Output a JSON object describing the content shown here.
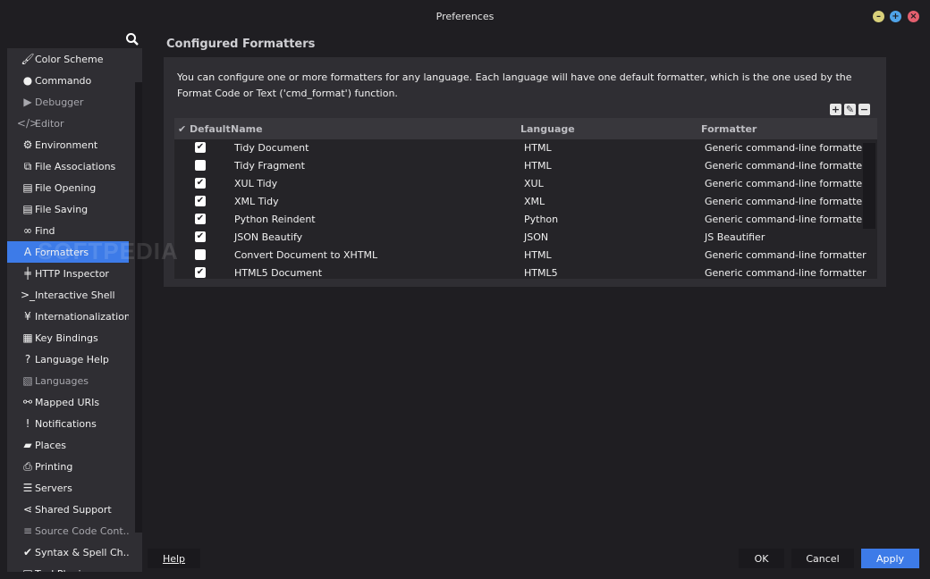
{
  "window": {
    "title": "Preferences"
  },
  "sidebar": {
    "items": [
      {
        "label": "Color Scheme",
        "icon": "brush-icon",
        "glyph": "🖌",
        "dim": false,
        "active": false
      },
      {
        "label": "Commando",
        "icon": "pin-icon",
        "glyph": "●",
        "dim": false,
        "active": false
      },
      {
        "label": "Debugger",
        "icon": "play-icon",
        "glyph": "▶",
        "dim": true,
        "active": false
      },
      {
        "label": "Editor",
        "icon": "code-icon",
        "glyph": "</>",
        "dim": true,
        "active": false
      },
      {
        "label": "Environment",
        "icon": "gear-icon",
        "glyph": "⚙",
        "dim": false,
        "active": false
      },
      {
        "label": "File Associations",
        "icon": "files-icon",
        "glyph": "⧉",
        "dim": false,
        "active": false
      },
      {
        "label": "File Opening",
        "icon": "file-icon",
        "glyph": "▤",
        "dim": false,
        "active": false
      },
      {
        "label": "File Saving",
        "icon": "file-save-icon",
        "glyph": "▤",
        "dim": false,
        "active": false
      },
      {
        "label": "Find",
        "icon": "binoculars-icon",
        "glyph": "∞",
        "dim": false,
        "active": false
      },
      {
        "label": "Formatters",
        "icon": "font-icon",
        "glyph": "A",
        "dim": false,
        "active": true
      },
      {
        "label": "HTTP Inspector",
        "icon": "sliders-icon",
        "glyph": "╪",
        "dim": false,
        "active": false
      },
      {
        "label": "Interactive Shell",
        "icon": "terminal-icon",
        "glyph": ">_",
        "dim": false,
        "active": false
      },
      {
        "label": "Internationalization",
        "icon": "yen-icon",
        "glyph": "¥",
        "dim": false,
        "active": false
      },
      {
        "label": "Key Bindings",
        "icon": "keyboard-icon",
        "glyph": "▦",
        "dim": false,
        "active": false
      },
      {
        "label": "Language Help",
        "icon": "help-icon",
        "glyph": "?",
        "dim": false,
        "active": false
      },
      {
        "label": "Languages",
        "icon": "languages-icon",
        "glyph": "▧",
        "dim": true,
        "active": false
      },
      {
        "label": "Mapped URIs",
        "icon": "link-icon",
        "glyph": "⚯",
        "dim": false,
        "active": false
      },
      {
        "label": "Notifications",
        "icon": "alert-icon",
        "glyph": "!",
        "dim": false,
        "active": false
      },
      {
        "label": "Places",
        "icon": "folder-icon",
        "glyph": "▰",
        "dim": false,
        "active": false
      },
      {
        "label": "Printing",
        "icon": "printer-icon",
        "glyph": "⎙",
        "dim": false,
        "active": false
      },
      {
        "label": "Servers",
        "icon": "server-icon",
        "glyph": "☰",
        "dim": false,
        "active": false
      },
      {
        "label": "Shared Support",
        "icon": "share-icon",
        "glyph": "⋖",
        "dim": false,
        "active": false
      },
      {
        "label": "Source Code Cont...",
        "icon": "database-icon",
        "glyph": "≡",
        "dim": true,
        "active": false
      },
      {
        "label": "Syntax & Spell Ch...",
        "icon": "check-circle-icon",
        "glyph": "✔",
        "dim": false,
        "active": false
      },
      {
        "label": "Tool Plugins",
        "icon": "plugin-icon",
        "glyph": "▣",
        "dim": false,
        "active": false
      }
    ]
  },
  "main": {
    "title": "Configured Formatters",
    "description": "You can configure one or more formatters for any language. Each language will have one default formatter, which is the one used by the Format Code or Text ('cmd_format') function.",
    "columns": {
      "default": "Default",
      "name": "Name",
      "language": "Language",
      "formatter": "Formatter"
    },
    "rows": [
      {
        "checked": true,
        "name": "Tidy Document",
        "language": "HTML",
        "formatter": "Generic command-line formatter"
      },
      {
        "checked": false,
        "name": "Tidy Fragment",
        "language": "HTML",
        "formatter": "Generic command-line formatter"
      },
      {
        "checked": true,
        "name": "XUL Tidy",
        "language": "XUL",
        "formatter": "Generic command-line formatter"
      },
      {
        "checked": true,
        "name": "XML Tidy",
        "language": "XML",
        "formatter": "Generic command-line formatter"
      },
      {
        "checked": true,
        "name": "Python Reindent",
        "language": "Python",
        "formatter": "Generic command-line formatter"
      },
      {
        "checked": true,
        "name": "JSON Beautify",
        "language": "JSON",
        "formatter": "JS Beautifier"
      },
      {
        "checked": false,
        "name": "Convert Document to XHTML",
        "language": "HTML",
        "formatter": "Generic command-line formatter"
      },
      {
        "checked": true,
        "name": "HTML5 Document",
        "language": "HTML5",
        "formatter": "Generic command-line formatter"
      }
    ]
  },
  "buttons": {
    "help": "Help",
    "ok": "OK",
    "cancel": "Cancel",
    "apply": "Apply"
  },
  "watermark": "SOFTPEDIA",
  "colors": {
    "accent": "#3d7be8",
    "panel": "#2f2e33",
    "background": "#1f1e22"
  }
}
